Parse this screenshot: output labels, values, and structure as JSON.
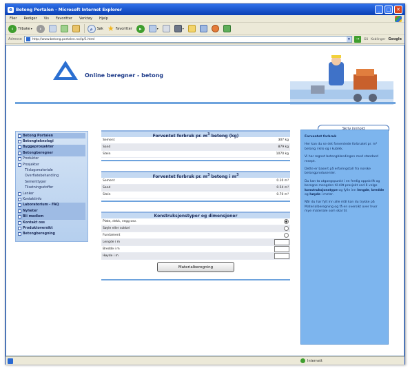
{
  "window": {
    "title": "Betong Portalen - Microsoft Internet Explorer",
    "controls": [
      "_",
      "□",
      "✕"
    ]
  },
  "menu": [
    "Filer",
    "Rediger",
    "Vis",
    "Favoritter",
    "Verktøy",
    "Hjelp"
  ],
  "toolbar": {
    "back_label": "Tilbake",
    "search_label": "Søk",
    "favorites_label": "Favoritter"
  },
  "address": {
    "label": "Adresse",
    "url": "http://www.betong.portalen.no/lp/1.html",
    "go_label": "Gå",
    "extra_label": "Koblinger",
    "links_label": "Google"
  },
  "page": {
    "title": "Online beregner - betong"
  },
  "sidebar": {
    "items": [
      {
        "label": "Betong Portalen",
        "bold": true,
        "hl": true,
        "sub": false
      },
      {
        "label": "Betongteknologi",
        "bold": true,
        "hl": false,
        "sub": false
      },
      {
        "label": "Byggeprosjekter",
        "bold": true,
        "hl": true,
        "sub": false
      },
      {
        "label": "Betongberegner",
        "bold": true,
        "hl": true,
        "sub": false
      },
      {
        "label": "Produkter",
        "bold": false,
        "hl": false,
        "sub": false
      },
      {
        "label": "Prosjekter",
        "bold": false,
        "hl": false,
        "sub": false
      },
      {
        "label": "Tilslagsmateriale",
        "bold": false,
        "hl": false,
        "sub": true
      },
      {
        "label": "Overflatebehandling",
        "bold": false,
        "hl": false,
        "sub": true
      },
      {
        "label": "Sementtyper",
        "bold": false,
        "hl": false,
        "sub": true
      },
      {
        "label": "Tilsetningsstoffer",
        "bold": false,
        "hl": false,
        "sub": true
      },
      {
        "label": "Lenker",
        "bold": false,
        "hl": false,
        "sub": false
      },
      {
        "label": "Kontaktinfo",
        "bold": false,
        "hl": false,
        "sub": false
      },
      {
        "label": "Laboratorium - FAQ",
        "bold": true,
        "hl": true,
        "sub": false
      },
      {
        "label": "Nyheter",
        "bold": true,
        "hl": true,
        "sub": false
      },
      {
        "label": "Bli medlem",
        "bold": true,
        "hl": true,
        "sub": false
      },
      {
        "label": "Kontakt oss",
        "bold": true,
        "hl": false,
        "sub": false
      },
      {
        "label": "Produktoversikt",
        "bold": true,
        "hl": false,
        "sub": false
      },
      {
        "label": "Betongberegning",
        "bold": true,
        "hl": false,
        "sub": false
      }
    ]
  },
  "section1": {
    "title_main": "Forventet forbruk pr. m",
    "title_sup": "3",
    "title_end": " betong (kg)",
    "rows": [
      {
        "name": "Sement",
        "value": "307 kg"
      },
      {
        "name": "Sand",
        "value": "879 kg"
      },
      {
        "name": "Stein",
        "value": "1070 kg"
      }
    ]
  },
  "section2": {
    "title_main": "Forventet forbruk pr. m",
    "title_sup": "3",
    "title_end": " betong i m",
    "title_sup2": "3",
    "rows": [
      {
        "name": "Sement",
        "value": "0.10 m³"
      },
      {
        "name": "Sand",
        "value": "0.54 m³"
      },
      {
        "name": "Stein",
        "value": "0.70 m³"
      }
    ]
  },
  "section3": {
    "title": "Konstruksjonstyper og dimensjoner",
    "radios": [
      {
        "name": "Plate, dekk, vegg osv.",
        "checked": true
      },
      {
        "name": "Søyle eller sokkel",
        "checked": false
      },
      {
        "name": "Fundament",
        "checked": false
      }
    ],
    "inputs": [
      {
        "name": "Lengde i m",
        "value": ""
      },
      {
        "name": "Bredde i m",
        "value": ""
      },
      {
        "name": "Høyde i m",
        "value": ""
      }
    ],
    "button_label": "Materialberegning"
  },
  "rightpanel": {
    "button_label": "Skriv innhold",
    "heading": "Forventet forbruk",
    "p1": "Her kan du se det forventede forbruket pr. m³ betong i kilo og i kubikk.",
    "p2": "Vi har regnet betongblandingen med standard resept.",
    "p3": "Dette er basert på erfaringstall fra norske betongprodusenter.",
    "p4_pre": "Du kan ta utgangspunkt i en ferdig oppskrift og beregne mengden til ditt prosjekt ved å velge ",
    "p4_b1": "konstruksjonstype",
    "p4_mid": " og fylle inn ",
    "p4_b2": "lengde",
    "p4_mid2": ", ",
    "p4_b3": "bredde",
    "p4_mid3": " og ",
    "p4_b4": "høyde",
    "p4_end": " i meter.",
    "p5": "Når du har fylt inn alle mål kan du trykke på Materialberegning og få en oversikt over hvor mye materiale som skal til."
  },
  "status": {
    "zone": "Internett"
  },
  "colors": {
    "accent": "#6ea3dd",
    "panel": "#7db5ee",
    "title_blue": "#1f3c8a"
  }
}
